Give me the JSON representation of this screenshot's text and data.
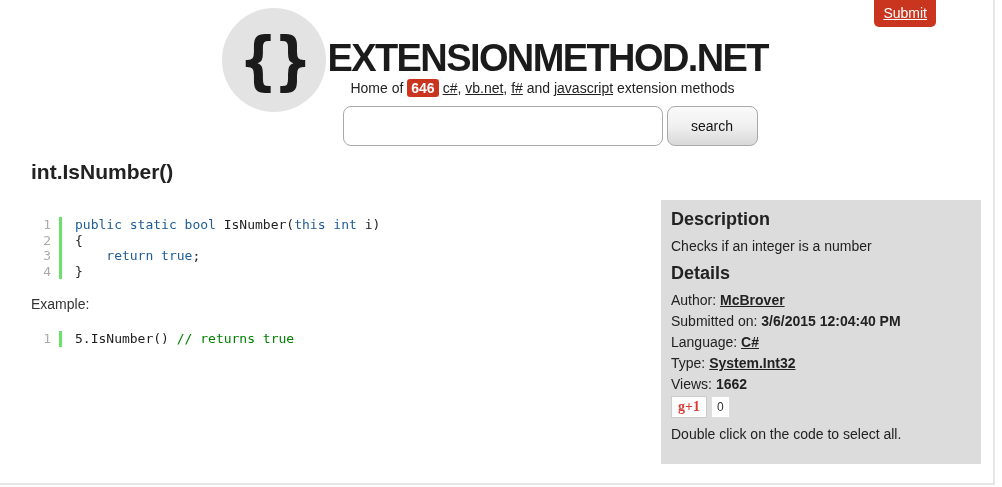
{
  "submit_button": "Submit",
  "site_title": "EXTENSIONMETHOD.NET",
  "logo_glyph": "{}",
  "tagline": [
    {
      "text": "Home of ",
      "kind": "plain"
    },
    {
      "text": "646",
      "kind": "badge"
    },
    {
      "text": "c#",
      "kind": "link"
    },
    {
      "text": ", ",
      "kind": "plain"
    },
    {
      "text": "vb.net",
      "kind": "link"
    },
    {
      "text": ", ",
      "kind": "plain"
    },
    {
      "text": "f#",
      "kind": "link"
    },
    {
      "text": " and ",
      "kind": "plain"
    },
    {
      "text": "javascript",
      "kind": "link"
    },
    {
      "text": " extension methods",
      "kind": "plain"
    }
  ],
  "search": {
    "button": "search"
  },
  "method_title": "int.IsNumber()",
  "code": [
    {
      "number": "1",
      "tokens": [
        {
          "text": "public static bool ",
          "kind": "keyword"
        },
        {
          "text": "IsNumber(",
          "kind": "plain"
        },
        {
          "text": "this int ",
          "kind": "keyword"
        },
        {
          "text": "i)",
          "kind": "plain"
        }
      ]
    },
    {
      "number": "2",
      "tokens": [
        {
          "text": "{",
          "kind": "plain"
        }
      ]
    },
    {
      "number": "3",
      "tokens": [
        {
          "text": "    return true",
          "kind": "keyword"
        },
        {
          "text": ";",
          "kind": "plain"
        }
      ]
    },
    {
      "number": "4",
      "tokens": [
        {
          "text": "}",
          "kind": "plain"
        }
      ]
    }
  ],
  "example_label": "Example:",
  "example_code": [
    {
      "number": "1",
      "tokens": [
        {
          "text": "5.IsNumber() ",
          "kind": "plain"
        },
        {
          "text": "// returns true",
          "kind": "comment"
        }
      ]
    }
  ],
  "sidebar": {
    "description_heading": "Description",
    "description": "Checks if an integer is a number",
    "details_heading": "Details",
    "details": [
      {
        "label": "Author: ",
        "value": "McBrover",
        "kind": "link"
      },
      {
        "label": "Submitted on: ",
        "value": "3/6/2015 12:04:40 PM",
        "kind": "bold"
      },
      {
        "label": "Language: ",
        "value": "C#",
        "kind": "link"
      },
      {
        "label": "Type: ",
        "value": "System.Int32",
        "kind": "link"
      },
      {
        "label": "Views: ",
        "value": "1662",
        "kind": "bold"
      }
    ],
    "plus_one": {
      "label": "g+1",
      "count": "0"
    },
    "hint": "Double click on the code to select all."
  }
}
